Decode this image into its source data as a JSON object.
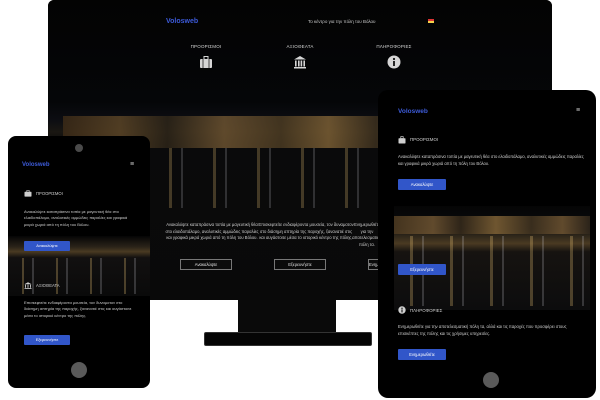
{
  "brand": {
    "name": "Volosweb",
    "color": "#3d5bd9"
  },
  "accent": "#3156c9",
  "desktop": {
    "tagline": "Το κέντρο για την πόλη του Βόλου",
    "columns": [
      {
        "title": "ΠΡΟΟΡΙΣΜΟΙ",
        "icon": "suitcase-icon"
      },
      {
        "title": "ΑΞΙΟΘΕΑΤΑ",
        "icon": "museum-icon"
      },
      {
        "title": "ΠΛΗΡΟΦΟΡΙΕΣ",
        "icon": "info-icon"
      }
    ],
    "texts": [
      "Ανακαλύψτε καταπράσινα τοπία με μαγευτική θέα στο ελαιδοπάλαμο, αναλυτικές αμμώδεις παραλίες και γραφικά μικρά χωριά από τη πόλη του Βόλου.",
      "Επισκεφτείτε ενδιαφέροντα μουσεία, τον δυναμοτον στο διάσημη απτηρία της παροχής, ξανανατιέ στις και αυγάστοιτε μέσα το ιστορικό κέντρο της πόλης.",
      "Ενημερωθείτε για την αποτελεσματική πόλη τα."
    ],
    "buttons": [
      "Ανακαλύψτε",
      "Εξερευνήστε",
      "Ενημερωθείτε"
    ]
  },
  "phone": {
    "menu": "≡",
    "sections": [
      {
        "title": "ΠΡΟΟΡΙΣΜΟΙ",
        "icon": "suitcase-icon",
        "text": "Ανακαλύψτε καταπράσινα τοπία με μαγευτική θέα στο ελαιδοπάλαμο, αναλυτικές αμμώδεις παραλίες και γραφικά μικρά χωριά από τη πόλη του Βόλου.",
        "button": "Ανακαλύψτε"
      },
      {
        "title": "ΑΞΙΟΘΕΑΤΑ",
        "icon": "museum-icon",
        "text": "Επισκεφτείτε ενδιαφέροντα μουσεία, τον δυναμοτον στο διάσημη απτηρία της παροχής, ξανανατιέ στις και αυγάστοιτε μέσα το ιστορικό κέντρο της πόλης.",
        "button": "Εξερευνήστε"
      }
    ]
  },
  "tablet": {
    "menu": "≡",
    "sections": [
      {
        "title": "ΠΡΟΟΡΙΣΜΟΙ",
        "icon": "suitcase-icon",
        "text": "Ανακαλύψτε καταπράσινα τοπία με μαγευτική θέα στο ελαιδοπάλαμο, αναλυτικές αμμώδεις παραλίες και γραφικά μικρά χωριά από τη πόλη του Βόλου.",
        "button": "Ανακαλύψτε"
      },
      {
        "title": "",
        "icon": "",
        "text": "",
        "button": "Εξερευνήστε"
      },
      {
        "title": "ΠΛΗΡΟΦΟΡΙΕΣ",
        "icon": "info-icon",
        "text": "Ενημερωθείτε για την αποτελεσματική πόλη τα, αλλά και τις παροχές που προσφέρει στους επισκέπτες της πόλης και τις χρήσιμες υπηρεσίες.",
        "button": "Ενημερωθείτε"
      }
    ]
  }
}
